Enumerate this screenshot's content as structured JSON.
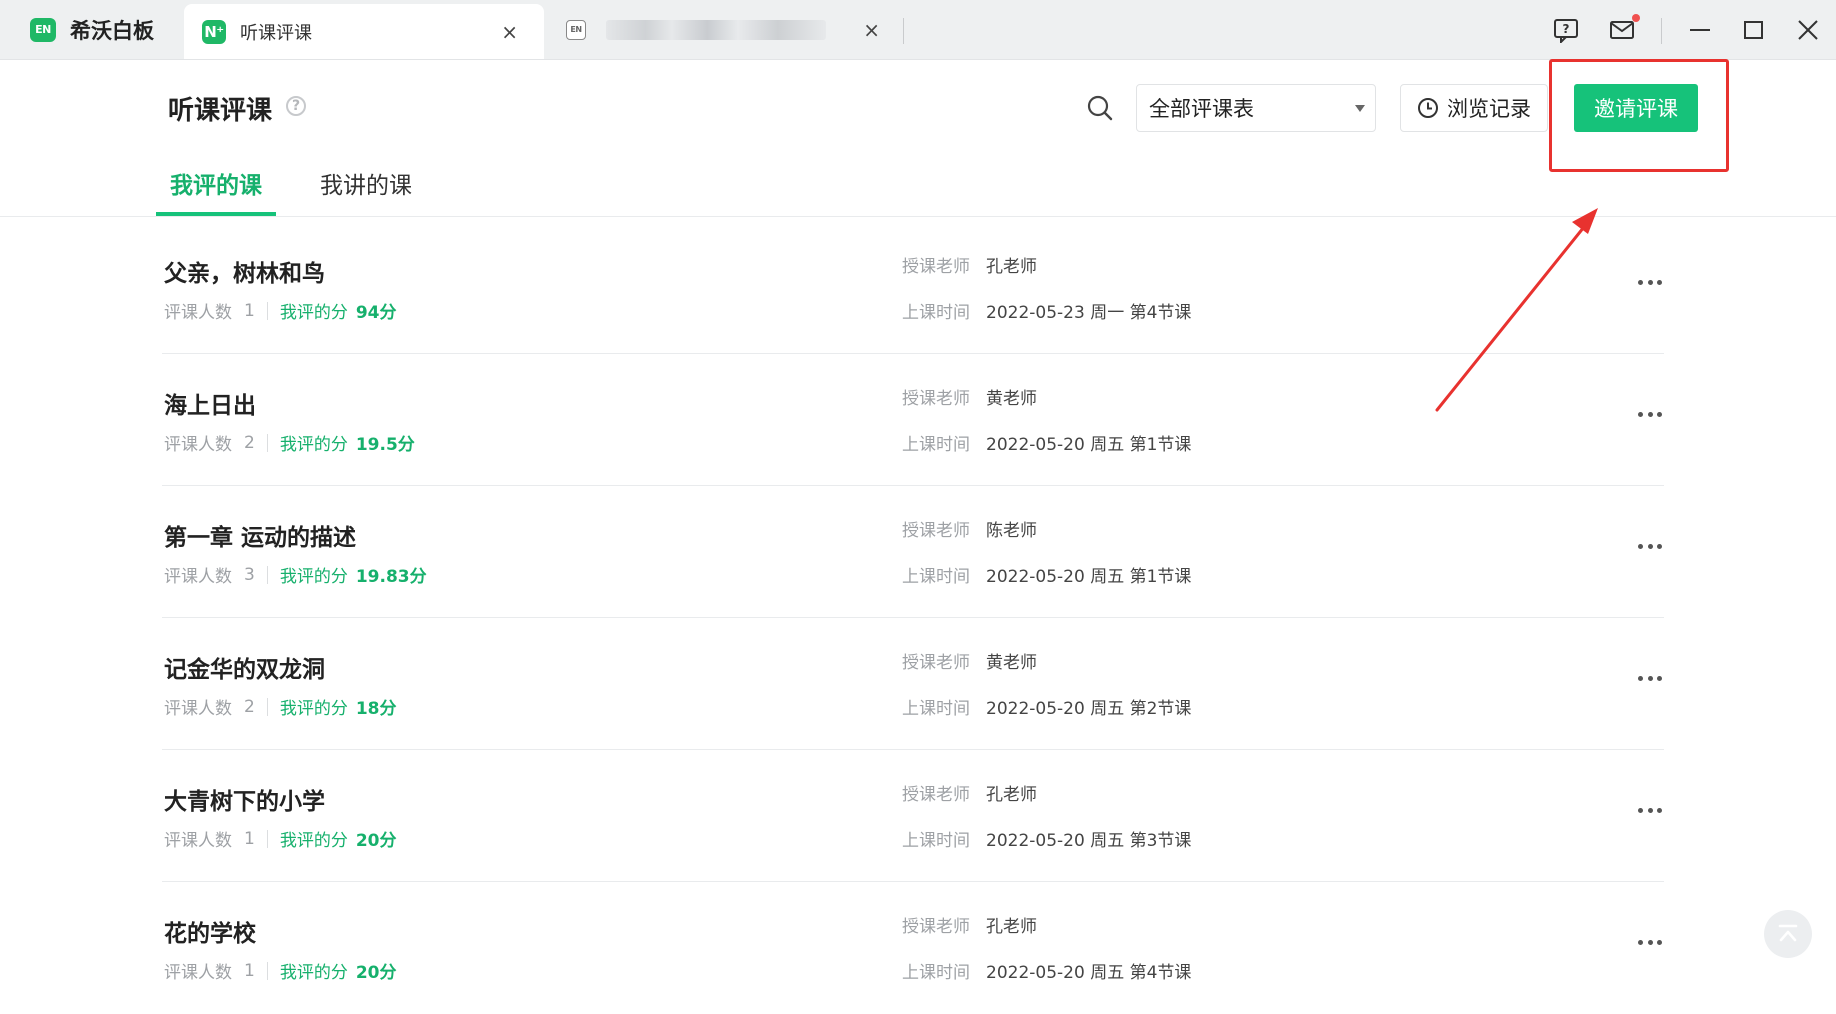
{
  "titlebar": {
    "tabs": [
      {
        "label": "希沃白板",
        "logo": "EN"
      },
      {
        "label": "听课评课",
        "logo": "N⁺"
      },
      {
        "label": "",
        "logo": "EN"
      }
    ],
    "close_symbol": "×",
    "window_controls": [
      "feedback-icon",
      "mail-icon",
      "minimize-icon",
      "maximize-icon",
      "close-icon"
    ]
  },
  "header": {
    "title": "听课评课",
    "help": "?",
    "filter_selected": "全部评课表",
    "history_label": "浏览记录",
    "invite_label": "邀请评课"
  },
  "page_tabs": [
    {
      "label": "我评的课",
      "active": true
    },
    {
      "label": "我讲的课",
      "active": false
    }
  ],
  "labels": {
    "review_count": "评课人数",
    "my_score": "我评的分",
    "teacher": "授课老师",
    "class_time": "上课时间"
  },
  "courses": [
    {
      "title": "父亲，树林和鸟",
      "count": "1",
      "score": "94分",
      "teacher": "孔老师",
      "time": "2022-05-23 周一 第4节课"
    },
    {
      "title": "海上日出",
      "count": "2",
      "score": "19.5分",
      "teacher": "黄老师",
      "time": "2022-05-20 周五 第1节课"
    },
    {
      "title": "第一章 运动的描述",
      "count": "3",
      "score": "19.83分",
      "teacher": "陈老师",
      "time": "2022-05-20 周五 第1节课"
    },
    {
      "title": "记金华的双龙洞",
      "count": "2",
      "score": "18分",
      "teacher": "黄老师",
      "time": "2022-05-20 周五 第2节课"
    },
    {
      "title": "大青树下的小学",
      "count": "1",
      "score": "20分",
      "teacher": "孔老师",
      "time": "2022-05-20 周五 第3节课"
    },
    {
      "title": "花的学校",
      "count": "1",
      "score": "20分",
      "teacher": "孔老师",
      "time": "2022-05-20 周五 第4节课"
    }
  ],
  "colors": {
    "accent": "#16c27a",
    "annotation": "#e8322f"
  }
}
